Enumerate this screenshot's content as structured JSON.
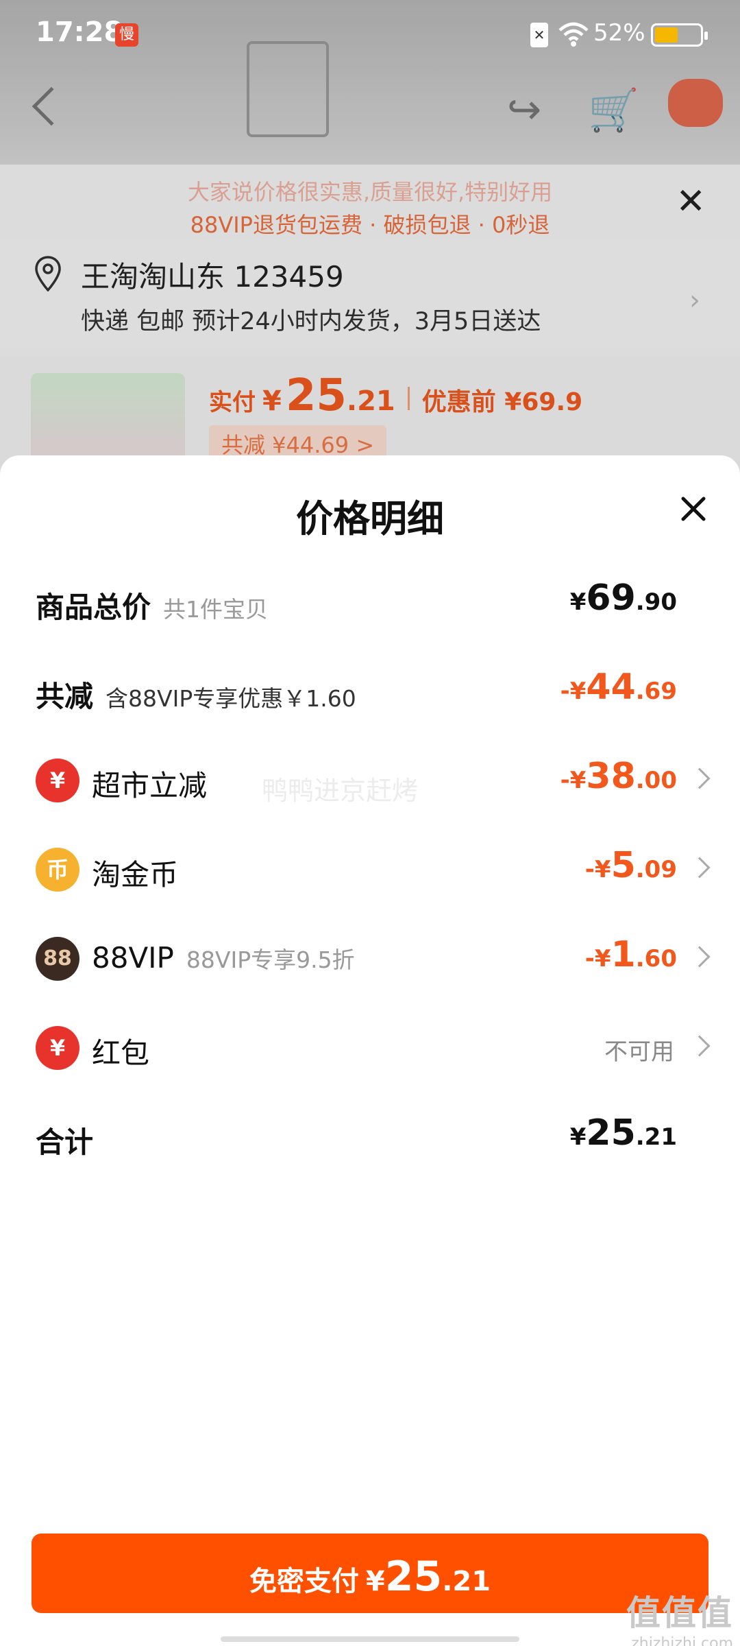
{
  "status_bar": {
    "time": "17:28",
    "notif_badge": "慢",
    "sim_badge": "✕",
    "battery_pct": "52%",
    "battery_level": 0.52
  },
  "background": {
    "banner_line1": "大家说价格很实惠,质量很好,特别好用",
    "banner_line2": "88VIP退货包运费 · 破损包退 · 0秒退",
    "address": "王淘淘山东 123459",
    "delivery": "快递 包邮 预计24小时内发货，3月5日送达",
    "pay_label": "实付",
    "pay_currency": "¥",
    "pay_int": "25",
    "pay_dec": ".21",
    "before_label": "优惠前 ¥69.9",
    "saved_label": "共减 ¥44.69 >"
  },
  "sheet": {
    "title": "价格明细",
    "rows": [
      {
        "label": "商品总价",
        "sub": "共1件宝贝",
        "cur": "¥",
        "int": "69",
        "dec": ".90"
      },
      {
        "label": "共减",
        "sub": "含88VIP专享优惠￥1.60",
        "cur": "-¥",
        "int": "44",
        "dec": ".69"
      },
      {
        "label": "超市立减",
        "icon": "¥",
        "cur": "-¥",
        "int": "38",
        "dec": ".00"
      },
      {
        "label": "淘金币",
        "icon": "币",
        "cur": "-¥",
        "int": "5",
        "dec": ".09"
      },
      {
        "label": "88VIP",
        "sub": "88VIP专享9.5折",
        "icon": "88",
        "cur": "-¥",
        "int": "1",
        "dec": ".60"
      },
      {
        "label": "红包",
        "icon": "¥",
        "status": "不可用"
      },
      {
        "label": "合计",
        "cur": "¥",
        "int": "25",
        "dec": ".21"
      }
    ],
    "watermark": "鸭鸭进京赶烤"
  },
  "pay_button": {
    "label": "免密支付",
    "cur": "¥",
    "int": "25",
    "dec": ".21"
  },
  "site_watermark": {
    "glyphs": "值值值",
    "domain": "zhizhizhi.com"
  },
  "colors": {
    "accent": "#ff5000",
    "discount": "#f2571c",
    "icon_red": "#e8322c",
    "icon_gold": "#f6b12e",
    "icon_dark": "#3a2a22"
  }
}
